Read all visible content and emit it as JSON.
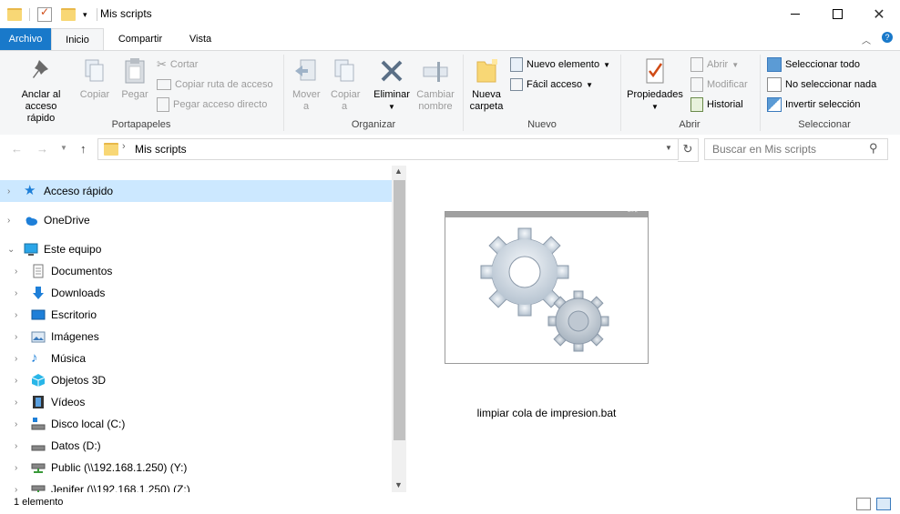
{
  "window": {
    "title": "Mis scripts"
  },
  "tabs": {
    "file": "Archivo",
    "home": "Inicio",
    "share": "Compartir",
    "view": "Vista"
  },
  "ribbon": {
    "clipboard": {
      "label": "Portapapeles",
      "pin": "Anclar al acceso rápido",
      "copy": "Copiar",
      "paste": "Pegar",
      "cut": "Cortar",
      "copy_path": "Copiar ruta de acceso",
      "paste_shortcut": "Pegar acceso directo"
    },
    "organize": {
      "label": "Organizar",
      "move": "Mover a",
      "copy_to": "Copiar a",
      "delete": "Eliminar",
      "rename": "Cambiar nombre"
    },
    "new": {
      "label": "Nuevo",
      "new_folder": "Nueva carpeta",
      "new_item": "Nuevo elemento",
      "easy_access": "Fácil acceso"
    },
    "open": {
      "label": "Abrir",
      "properties": "Propiedades",
      "open": "Abrir",
      "edit": "Modificar",
      "history": "Historial"
    },
    "select": {
      "label": "Seleccionar",
      "select_all": "Seleccionar todo",
      "select_none": "No seleccionar nada",
      "invert": "Invertir selección"
    }
  },
  "address": {
    "path": "Mis scripts",
    "search_placeholder": "Buscar en Mis scripts"
  },
  "nav": {
    "items": [
      {
        "label": "Acceso rápido",
        "icon": "star-icon"
      },
      {
        "label": "OneDrive",
        "icon": "cloud-icon"
      },
      {
        "label": "Este equipo",
        "icon": "computer-icon"
      },
      {
        "label": "Documentos",
        "icon": "document-icon"
      },
      {
        "label": "Downloads",
        "icon": "download-icon"
      },
      {
        "label": "Escritorio",
        "icon": "desktop-icon"
      },
      {
        "label": "Imágenes",
        "icon": "pictures-icon"
      },
      {
        "label": "Música",
        "icon": "music-icon"
      },
      {
        "label": "Objetos 3D",
        "icon": "3d-objects-icon"
      },
      {
        "label": "Vídeos",
        "icon": "video-icon"
      },
      {
        "label": "Disco local (C:)",
        "icon": "drive-icon"
      },
      {
        "label": "Datos (D:)",
        "icon": "drive-icon"
      },
      {
        "label": "Public (\\\\192.168.1.250) (Y:)",
        "icon": "network-drive-icon"
      },
      {
        "label": "Jenifer (\\\\192.168.1.250) (Z:)",
        "icon": "network-drive-icon"
      }
    ]
  },
  "content": {
    "file_name": "limpiar cola de impresion.bat"
  },
  "status": {
    "count": "1 elemento"
  },
  "colors": {
    "accent": "#1979ca",
    "selection": "#cce8ff"
  }
}
